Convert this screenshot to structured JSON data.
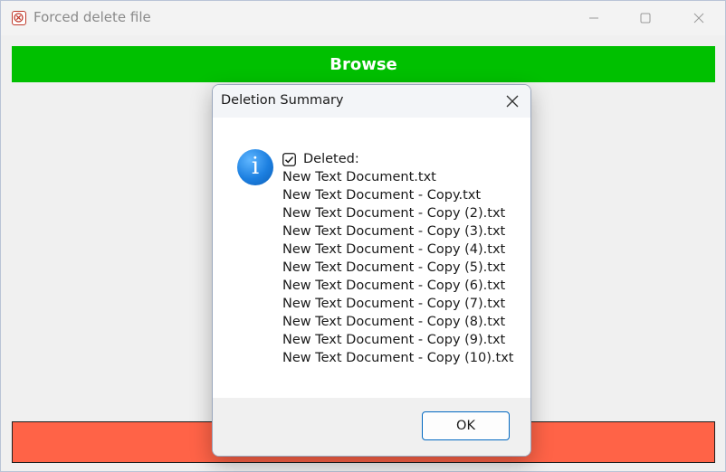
{
  "window": {
    "title": "Forced delete file"
  },
  "main": {
    "browse_label": "Browse",
    "browse_color": "#00c000",
    "delete_color": "#ff6347"
  },
  "dialog": {
    "title": "Deletion Summary",
    "heading": "Deleted:",
    "icon": "info-icon",
    "files": [
      "New Text Document.txt",
      "New Text Document - Copy.txt",
      "New Text Document - Copy (2).txt",
      "New Text Document - Copy (3).txt",
      "New Text Document - Copy (4).txt",
      "New Text Document - Copy (5).txt",
      "New Text Document - Copy (6).txt",
      "New Text Document - Copy (7).txt",
      "New Text Document - Copy (8).txt",
      "New Text Document - Copy (9).txt",
      "New Text Document - Copy (10).txt"
    ],
    "ok_label": "OK"
  }
}
